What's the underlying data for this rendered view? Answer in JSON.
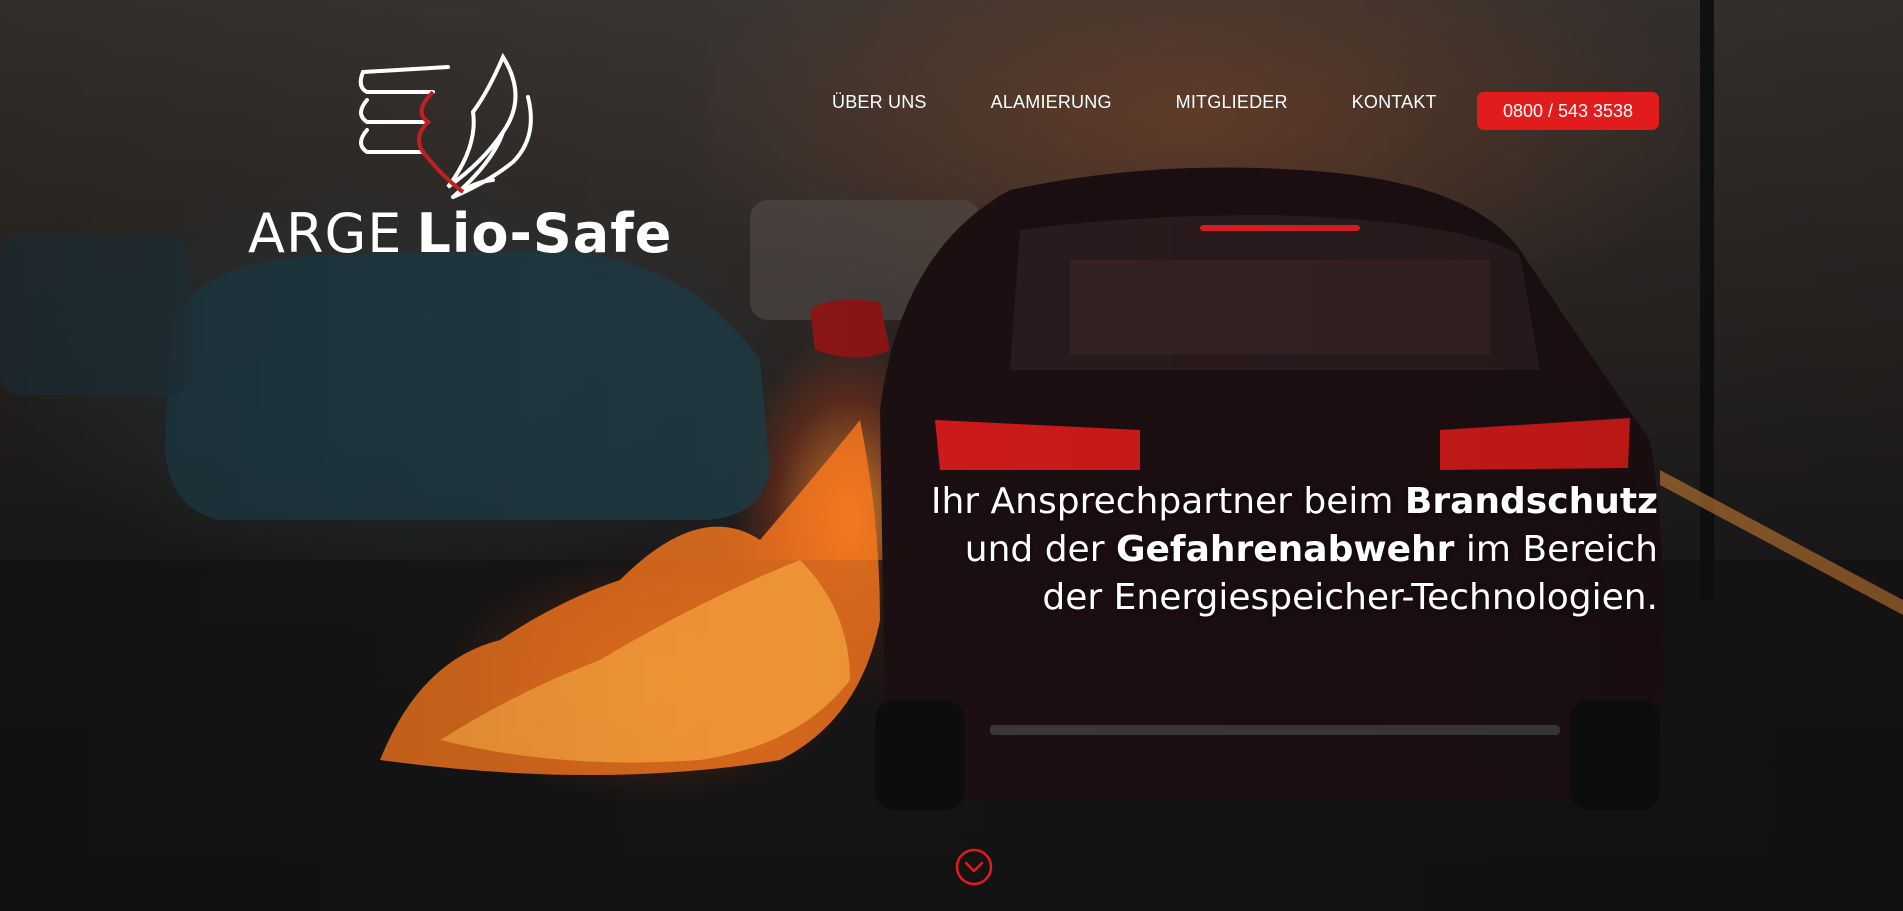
{
  "brand": {
    "name_light": "ARGE",
    "name_bold": "Lio-Safe"
  },
  "nav": {
    "items": [
      {
        "label": "ÜBER UNS"
      },
      {
        "label": "ALAMIERUNG"
      },
      {
        "label": "MITGLIEDER"
      },
      {
        "label": "KONTAKT"
      }
    ],
    "phone_label": "0800 / 543 3538"
  },
  "hero": {
    "line1_prefix": "Ihr Ansprechpartner beim ",
    "line1_bold": "Brandschutz",
    "line2_prefix": "und der ",
    "line2_bold": "Gefahrenabwehr",
    "line2_suffix": " im Bereich",
    "line3": "der Energiespeicher-Technologien."
  },
  "colors": {
    "accent": "#e21c1c",
    "text": "#ffffff"
  },
  "icons": {
    "logo": "flame-wing-logo-icon",
    "scroll": "chevron-down-circle-icon"
  }
}
